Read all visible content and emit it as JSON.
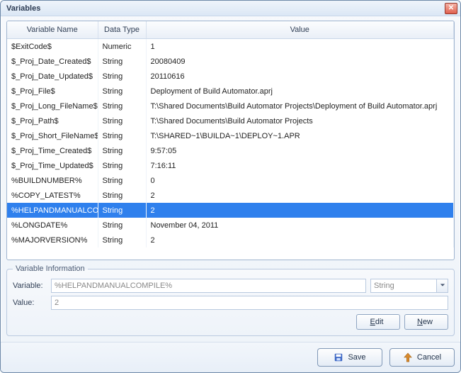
{
  "window": {
    "title": "Variables"
  },
  "table": {
    "headers": {
      "name": "Variable Name",
      "type": "Data Type",
      "value": "Value"
    },
    "rows": [
      {
        "name": "$ExitCode$",
        "type": "Numeric",
        "value": "1",
        "selected": false
      },
      {
        "name": "$_Proj_Date_Created$",
        "type": "String",
        "value": "20080409",
        "selected": false
      },
      {
        "name": "$_Proj_Date_Updated$",
        "type": "String",
        "value": "20110616",
        "selected": false
      },
      {
        "name": "$_Proj_File$",
        "type": "String",
        "value": "Deployment of Build Automator.aprj",
        "selected": false
      },
      {
        "name": "$_Proj_Long_FileName$",
        "type": "String",
        "value": "T:\\Shared Documents\\Build Automator Projects\\Deployment of Build Automator.aprj",
        "selected": false
      },
      {
        "name": "$_Proj_Path$",
        "type": "String",
        "value": "T:\\Shared Documents\\Build Automator Projects",
        "selected": false
      },
      {
        "name": "$_Proj_Short_FileName$",
        "type": "String",
        "value": "T:\\SHARED~1\\BUILDA~1\\DEPLOY~1.APR",
        "selected": false
      },
      {
        "name": "$_Proj_Time_Created$",
        "type": "String",
        "value": "9:57:05",
        "selected": false
      },
      {
        "name": "$_Proj_Time_Updated$",
        "type": "String",
        "value": "7:16:11",
        "selected": false
      },
      {
        "name": "%BUILDNUMBER%",
        "type": "String",
        "value": "0",
        "selected": false
      },
      {
        "name": "%COPY_LATEST%",
        "type": "String",
        "value": "2",
        "selected": false
      },
      {
        "name": "%HELPANDMANUALCOMPILE%",
        "type": "String",
        "value": "2",
        "selected": true
      },
      {
        "name": "%LONGDATE%",
        "type": "String",
        "value": "November 04, 2011",
        "selected": false
      },
      {
        "name": "%MAJORVERSION%",
        "type": "String",
        "value": "2",
        "selected": false
      }
    ]
  },
  "info": {
    "legend": "Variable Information",
    "variable_label": "Variable:",
    "variable_value": "%HELPANDMANUALCOMPILE%",
    "type_value": "String",
    "value_label": "Value:",
    "value_value": "2",
    "edit_label": "Edit",
    "new_label": "New"
  },
  "footer": {
    "save_label": "Save",
    "cancel_label": "Cancel"
  }
}
